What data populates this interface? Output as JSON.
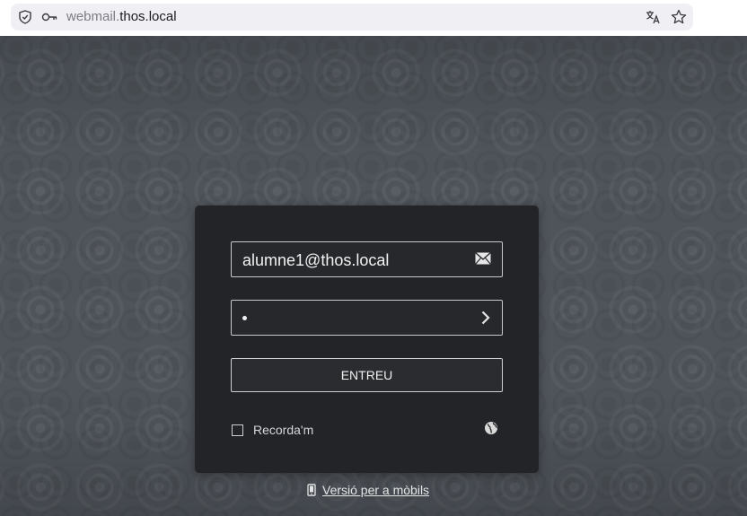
{
  "browser": {
    "url_host_prefix": "webmail.",
    "url_host_main": "thos.local"
  },
  "login": {
    "email_value": "alumne1@thos.local",
    "password_masked": "•",
    "submit_label": "ENTREU",
    "remember_label": "Recorda'm",
    "remember_checked": false
  },
  "footer": {
    "mobile_link_label": "Versió per a mòbils"
  },
  "icons": {
    "address_bar": [
      "shield-icon",
      "key-icon",
      "translate-icon",
      "bookmark-star-icon"
    ],
    "email_field": "envelope-icon",
    "password_field": "chevron-right-icon",
    "language": "globe-icon",
    "mobile": "mobile-phone-icon"
  }
}
